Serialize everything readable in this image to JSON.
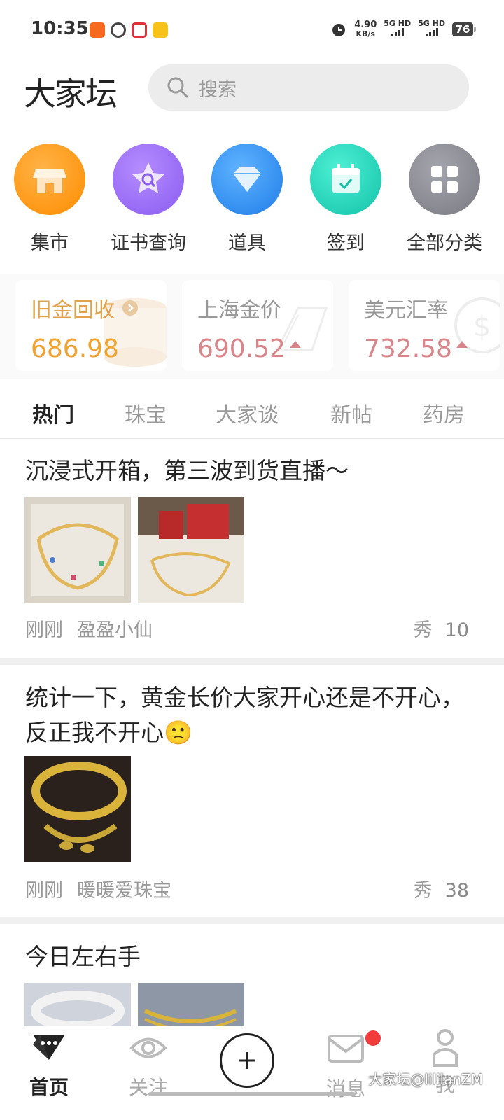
{
  "status_bar": {
    "time": "10:35",
    "net_speed": "4.90",
    "net_unit": "KB/s",
    "sim1": "5G HD",
    "sim2": "5G HD",
    "battery": "76"
  },
  "header": {
    "logo": "大家坛",
    "search_placeholder": "搜索"
  },
  "categories": [
    {
      "label": "集市",
      "icon": "shop-icon",
      "color": "#ff9a1f"
    },
    {
      "label": "证书查询",
      "icon": "star-search-icon",
      "color": "#9b6cf0"
    },
    {
      "label": "道具",
      "icon": "diamond-icon",
      "color": "#2f8ff2"
    },
    {
      "label": "签到",
      "icon": "calendar-icon",
      "color": "#1fd0b8"
    },
    {
      "label": "全部分类",
      "icon": "grid-icon",
      "color": "#8a8a92"
    }
  ],
  "prices": [
    {
      "title": "旧金回收",
      "value": "686.98",
      "color": "#f0a32e"
    },
    {
      "title": "上海金价",
      "value": "690.52",
      "color": "#d9868a"
    },
    {
      "title": "美元汇率",
      "value": "732.58",
      "color": "#d9868a"
    }
  ],
  "tabs": [
    "热门",
    "珠宝",
    "大家谈",
    "新帖",
    "药房"
  ],
  "posts": [
    {
      "title": "沉浸式开箱，第三波到货直播～",
      "time": "刚刚",
      "author": "盈盈小仙",
      "tag": "秀",
      "count": "10"
    },
    {
      "title": "统计一下，黄金长价大家开心还是不开心，反正我不开心🙁",
      "time": "刚刚",
      "author": "暖暖爱珠宝",
      "tag": "秀",
      "count": "38"
    },
    {
      "title": "今日左右手"
    }
  ],
  "bottom_nav": {
    "home": "首页",
    "follow": "关注",
    "messages": "消息",
    "me": "我",
    "watermark": "大家坛@lililanZM"
  }
}
